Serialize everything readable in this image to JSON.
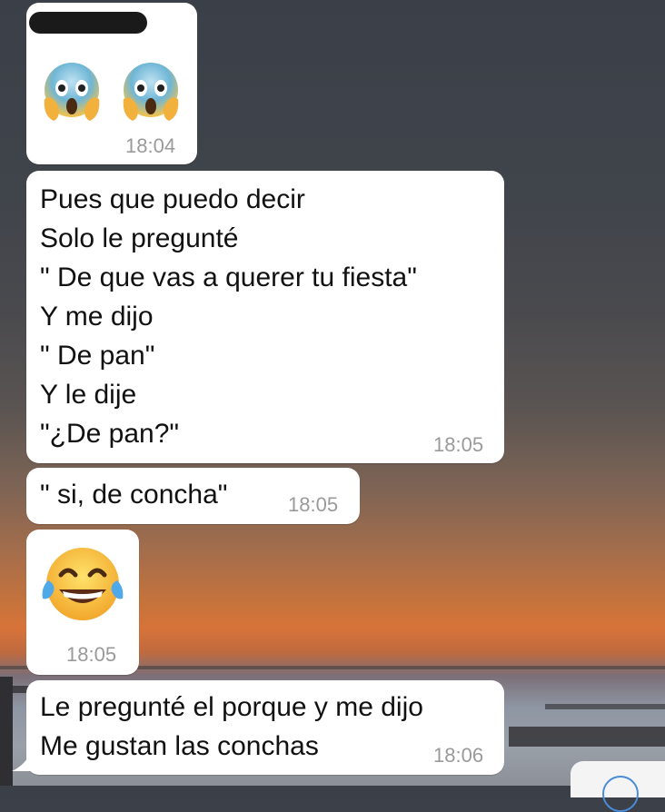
{
  "chat": {
    "messages": [
      {
        "kind": "emoji",
        "emojis": [
          "face-screaming-in-fear-icon",
          "face-screaming-in-fear-icon"
        ],
        "time": "18:04",
        "sender_redacted": true
      },
      {
        "kind": "text",
        "lines": [
          "Pues que puedo decir",
          "Solo le pregunté",
          "\" De que vas a querer tu fiesta\"",
          "Y me dijo",
          "\" De pan\"",
          "Y le dije",
          "\"¿De pan?\""
        ],
        "time": "18:05"
      },
      {
        "kind": "text",
        "lines": [
          "\" si, de concha\""
        ],
        "time": "18:05"
      },
      {
        "kind": "emoji",
        "emojis": [
          "face-with-tears-of-joy-icon"
        ],
        "time": "18:05"
      },
      {
        "kind": "text",
        "lines": [
          "Le pregunté el porque y me dijo",
          "Me gustan las conchas"
        ],
        "time": "18:06"
      }
    ]
  },
  "colors": {
    "bubble": "#ffffff",
    "timestamp": "#9a9a9a",
    "accent": "#4a8cd8"
  }
}
